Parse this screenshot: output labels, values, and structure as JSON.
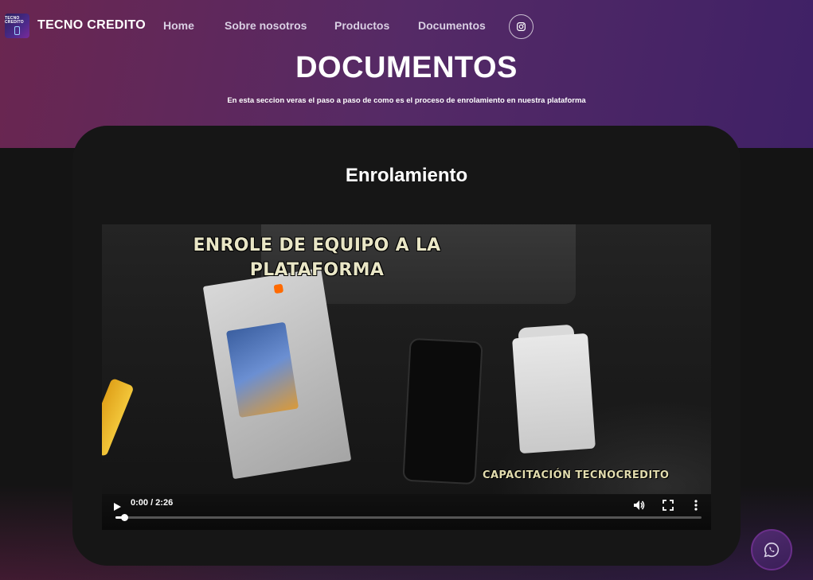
{
  "header": {
    "logo_text": "TECNO CREDITO",
    "brand": "TECNO CREDITO",
    "nav": [
      {
        "label": "Home"
      },
      {
        "label": "Sobre nosotros"
      },
      {
        "label": "Productos"
      },
      {
        "label": "Documentos"
      }
    ],
    "social_icon": "instagram-icon"
  },
  "hero": {
    "title": "DOCUMENTOS",
    "subtitle": "En esta seccion veras el paso a paso de como es el proceso de enrolamiento en nuestra plataforma"
  },
  "card": {
    "title": "Enrolamiento",
    "video": {
      "overlay_title_line1": "ENROLE DE EQUIPO A LA",
      "overlay_title_line2": "PLATAFORMA",
      "overlay_caption": "CAPACITACIÓN TECNOCREDITO",
      "time": "0:00 / 2:26",
      "progress": 0.015,
      "controls": [
        "play-icon",
        "volume-icon",
        "fullscreen-icon",
        "more-options-icon"
      ]
    }
  },
  "floating": {
    "whatsapp_icon": "whatsapp-icon"
  },
  "colors": {
    "header_gradient_start": "#6a2650",
    "header_gradient_end": "#3b1f66",
    "card_background": "#161616",
    "whatsapp_button": "#4f2a6e"
  }
}
